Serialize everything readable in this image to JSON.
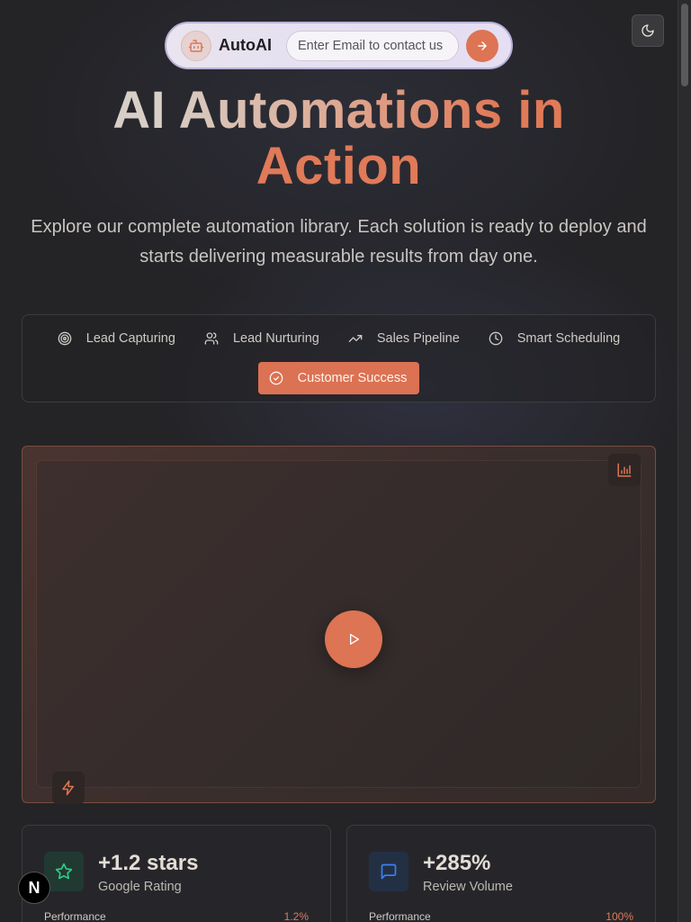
{
  "nav": {
    "brand": "AutoAI",
    "email_placeholder": "Enter Email to contact us",
    "send_icon": "arrow-right-icon",
    "logo_icon": "bot-icon",
    "theme_icon": "moon-icon"
  },
  "hero": {
    "title_line1": "AI Automations in",
    "title_line2": "Action",
    "subtitle": "Explore our complete automation library. Each solution is ready to deploy and starts delivering measurable results from day one."
  },
  "tabs": [
    {
      "label": "Lead Capturing",
      "icon": "target-icon",
      "active": false
    },
    {
      "label": "Lead Nurturing",
      "icon": "users-icon",
      "active": false
    },
    {
      "label": "Sales Pipeline",
      "icon": "trending-up-icon",
      "active": false
    },
    {
      "label": "Smart Scheduling",
      "icon": "clock-icon",
      "active": false
    },
    {
      "label": "Customer Success",
      "icon": "check-circle-icon",
      "active": true
    }
  ],
  "video": {
    "play_icon": "play-icon",
    "top_right_icon": "bar-chart-icon",
    "bottom_left_icon": "lightning-icon"
  },
  "stats": [
    {
      "value": "+1.2 stars",
      "label": "Google Rating",
      "perf_label": "Performance",
      "perf_value": "1.2%",
      "icon": "star-icon",
      "icon_color": "#2ecc8a"
    },
    {
      "value": "+285%",
      "label": "Review Volume",
      "perf_label": "Performance",
      "perf_value": "100%",
      "icon": "message-square-icon",
      "icon_color": "#3b82f6"
    }
  ],
  "badge": {
    "text": "N"
  },
  "colors": {
    "accent": "#dd7453",
    "background": "#242427"
  }
}
